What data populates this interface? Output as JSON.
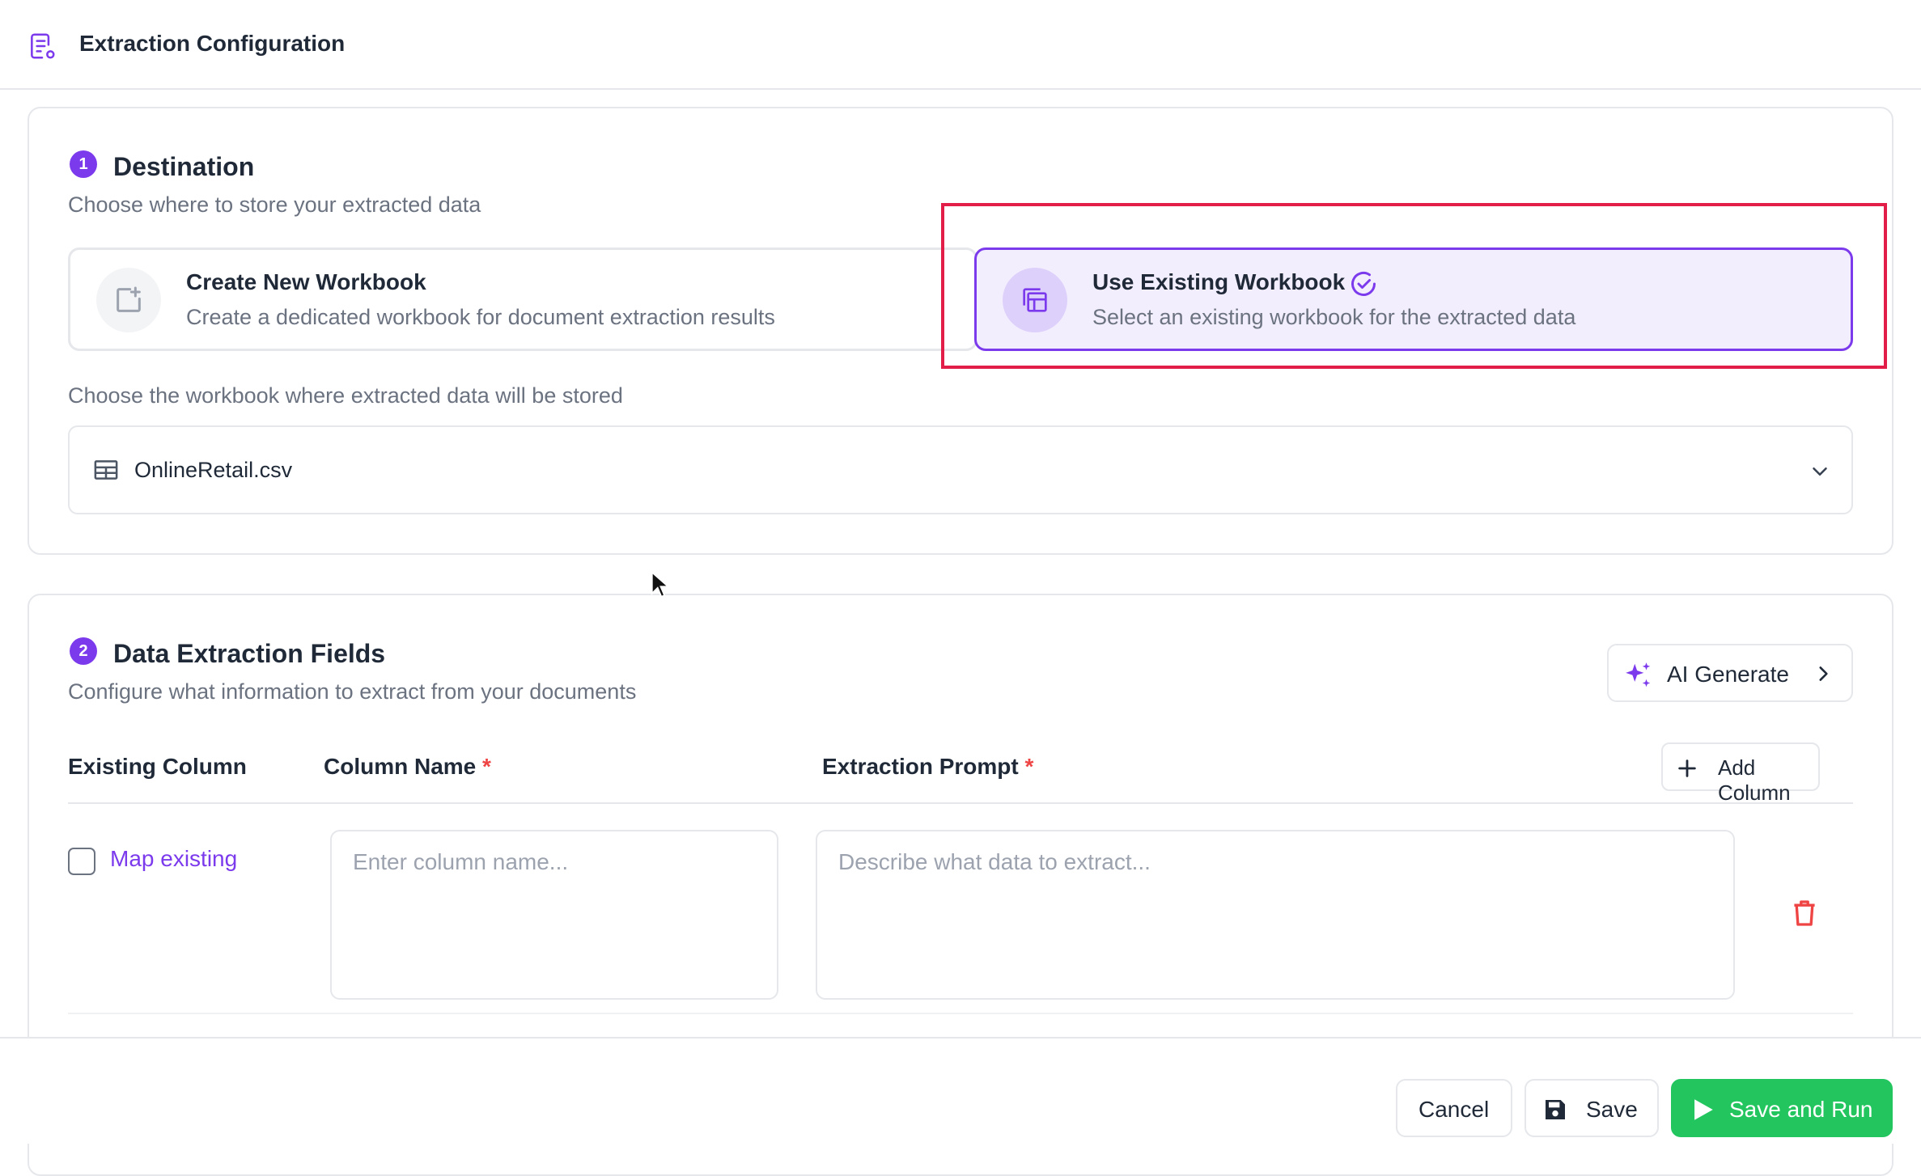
{
  "header": {
    "title": "Extraction Configuration",
    "icon": "document-config-icon"
  },
  "destination": {
    "step": "1",
    "title": "Destination",
    "subtitle": "Choose where to store your extracted data",
    "options": [
      {
        "title": "Create New Workbook",
        "description": "Create a dedicated workbook for document extraction results",
        "icon": "add-file-icon",
        "selected": false
      },
      {
        "title": "Use Existing Workbook",
        "description": "Select an existing workbook for the extracted data",
        "icon": "workbook-icon",
        "selected": true
      }
    ],
    "workbook_label": "Choose the workbook where extracted data will be stored",
    "selected_workbook": "OnlineRetail.csv"
  },
  "fields": {
    "step": "2",
    "title": "Data Extraction Fields",
    "subtitle": "Configure what information to extract from your documents",
    "ai_generate_label": "AI Generate",
    "columns": {
      "existing": "Existing Column",
      "name": "Column Name",
      "prompt": "Extraction Prompt",
      "required_mark": "*"
    },
    "add_column_label": "Add Column",
    "rows": [
      {
        "map_label": "Map existing",
        "map_checked": false,
        "name_placeholder": "Enter column name...",
        "prompt_placeholder": "Describe what data to extract..."
      }
    ]
  },
  "footer": {
    "cancel_label": "Cancel",
    "save_label": "Save",
    "save_run_label": "Save and Run"
  },
  "colors": {
    "accent": "#7c3aed",
    "selected_bg": "#f3eefe",
    "highlight": "#e11d48",
    "run_button": "#22c55e",
    "delete": "#ef4444"
  }
}
